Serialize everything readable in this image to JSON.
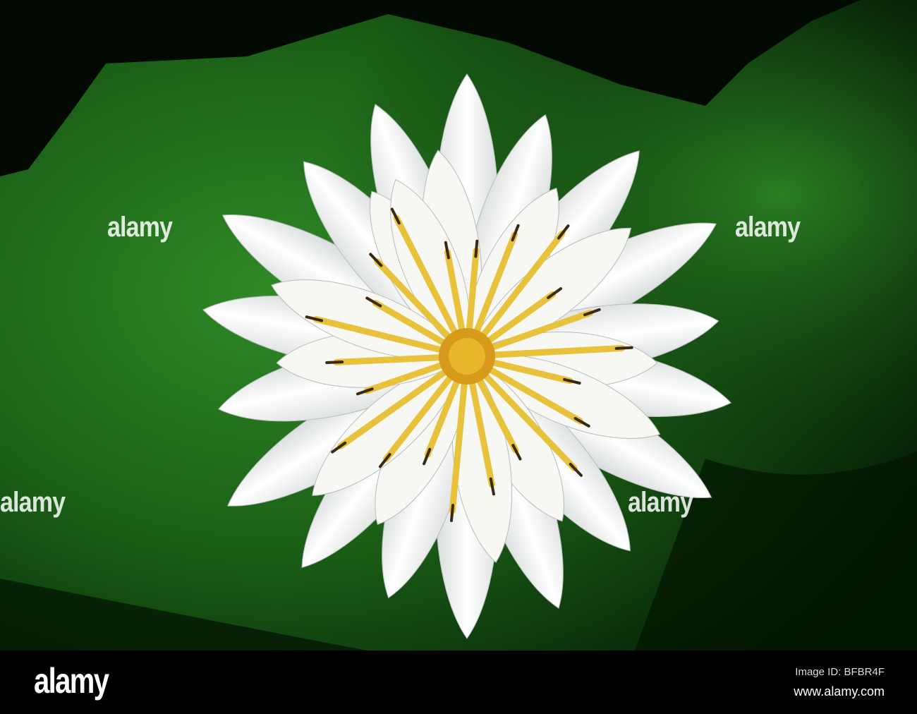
{
  "watermark": {
    "text": "alamy"
  },
  "footer": {
    "logo": "alamy",
    "image_id": "Image ID: BFBR4F",
    "url": "www.alamy.com"
  },
  "colors": {
    "leaf": "#1f6b1a",
    "leaf_dark": "#062406",
    "petal": "#f4f4f0",
    "stamen": "#e8c23a",
    "center": "#d79a1a"
  }
}
